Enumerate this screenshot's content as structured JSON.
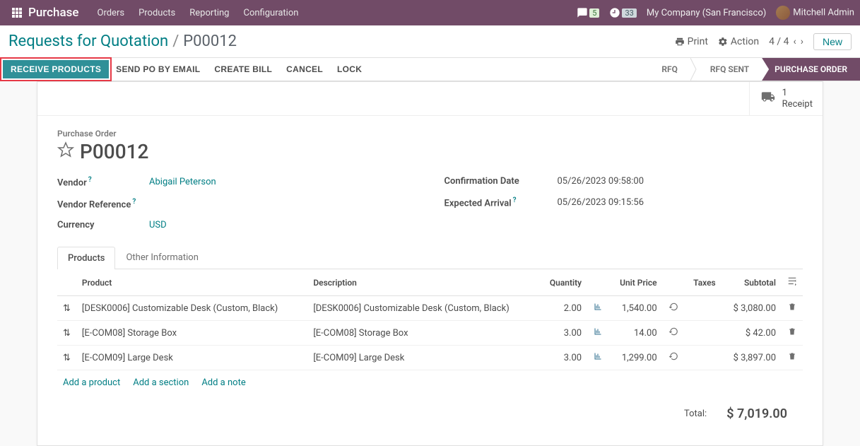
{
  "topbar": {
    "brand": "Purchase",
    "nav": [
      "Orders",
      "Products",
      "Reporting",
      "Configuration"
    ],
    "msg_count": "5",
    "timer_count": "33",
    "company": "My Company (San Francisco)",
    "user": "Mitchell Admin"
  },
  "breadcrumb": {
    "root": "Requests for Quotation",
    "current": "P00012",
    "print": "Print",
    "action": "Action",
    "pager": "4 / 4",
    "new": "New"
  },
  "actions": {
    "receive": "RECEIVE PRODUCTS",
    "send": "SEND PO BY EMAIL",
    "bill": "CREATE BILL",
    "cancel": "CANCEL",
    "lock": "LOCK"
  },
  "stages": {
    "rfq": "RFQ",
    "sent": "RFQ SENT",
    "po": "PURCHASE ORDER"
  },
  "stat": {
    "count": "1",
    "label": "Receipt"
  },
  "header": {
    "label": "Purchase Order",
    "name": "P00012"
  },
  "fields": {
    "vendor_label": "Vendor",
    "vendor": "Abigail Peterson",
    "vref_label": "Vendor Reference",
    "vref": "",
    "currency_label": "Currency",
    "currency": "USD",
    "confdate_label": "Confirmation Date",
    "confdate": "05/26/2023 09:58:00",
    "exparr_label": "Expected Arrival",
    "exparr": "05/26/2023 09:15:56"
  },
  "tabs": {
    "products": "Products",
    "other": "Other Information"
  },
  "table": {
    "headers": {
      "product": "Product",
      "desc": "Description",
      "qty": "Quantity",
      "price": "Unit Price",
      "taxes": "Taxes",
      "subtotal": "Subtotal"
    },
    "rows": [
      {
        "product": "[DESK0006] Customizable Desk (Custom, Black)",
        "desc": "[DESK0006] Customizable Desk (Custom, Black)",
        "qty": "2.00",
        "price": "1,540.00",
        "subtotal": "$ 3,080.00"
      },
      {
        "product": "[E-COM08] Storage Box",
        "desc": "[E-COM08] Storage Box",
        "qty": "3.00",
        "price": "14.00",
        "subtotal": "$ 42.00"
      },
      {
        "product": "[E-COM09] Large Desk",
        "desc": "[E-COM09] Large Desk",
        "qty": "3.00",
        "price": "1,299.00",
        "subtotal": "$ 3,897.00"
      }
    ],
    "add_product": "Add a product",
    "add_section": "Add a section",
    "add_note": "Add a note"
  },
  "totals": {
    "label": "Total:",
    "value": "$ 7,019.00"
  }
}
